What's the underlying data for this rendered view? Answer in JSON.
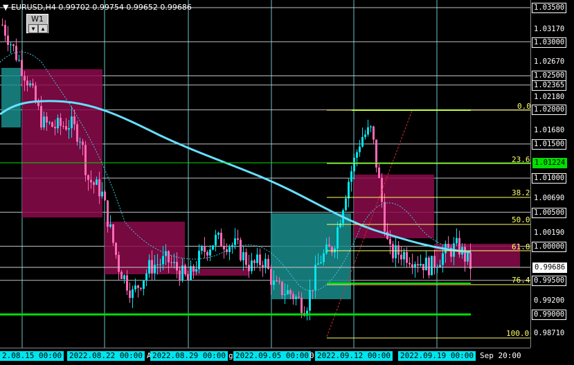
{
  "symbol": {
    "header_text": "EURUSD,H4  0.99702 0.99754 0.99652 0.99686",
    "timeframe_badge": "W1"
  },
  "price_axis": {
    "labels": [
      "1.03500",
      "1.03170",
      "1.03000",
      "1.02670",
      "1.02500",
      "1.02365",
      "1.02180",
      "1.02000",
      "1.01680",
      "1.01500",
      "1.01224",
      "1.01000",
      "1.00690",
      "1.00500",
      "1.00190",
      "1.00000",
      "0.99686",
      "0.99500",
      "0.99200",
      "0.99000",
      "0.98710"
    ],
    "boxed": [
      "1.03500",
      "1.03000",
      "1.02500",
      "1.02365",
      "1.02000",
      "1.01500",
      "1.01000",
      "1.00500",
      "1.00000",
      "0.99500",
      "0.99000"
    ],
    "current_price": "0.99686",
    "highlight_price": "1.01224"
  },
  "time_axis": {
    "labels": [
      "2.08.15 00:00",
      "2022.08.22 00:00",
      "2022.08.29 00:00",
      "2022.09.05 00:00",
      "2022.09.12 00:00",
      "2022.09.19 00:00",
      "Sep 20:00"
    ],
    "fragments": [
      "A",
      "g",
      "0"
    ]
  },
  "fibonacci": {
    "levels": [
      "0.0",
      "23.6",
      "38.2",
      "50.0",
      "61.8",
      "76.4",
      "100.0"
    ]
  },
  "colors": {
    "bull": "#00e5ee",
    "bear": "#ff69b4",
    "supply_zone": "#8b0a4a",
    "demand_zone": "#1a8c8c",
    "moving_average": "#66e0ff",
    "fib": "#ffff66",
    "support_line": "#00e000"
  }
}
